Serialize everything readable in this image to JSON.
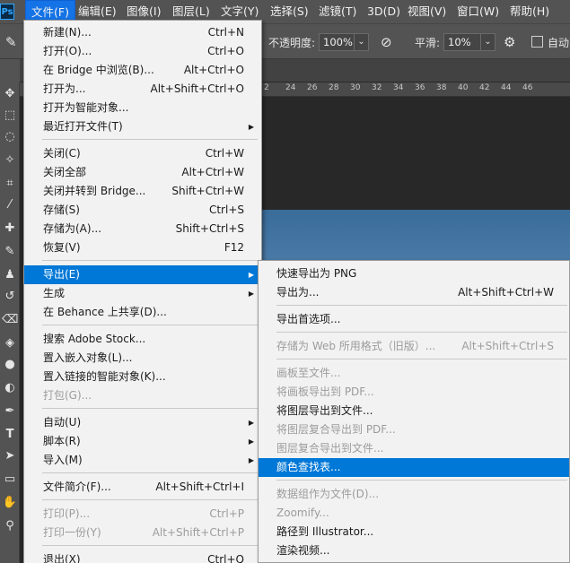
{
  "app": {
    "logo": "Ps"
  },
  "menubar": [
    {
      "label": "文件(F)",
      "active": true
    },
    {
      "label": "编辑(E)"
    },
    {
      "label": "图像(I)"
    },
    {
      "label": "图层(L)"
    },
    {
      "label": "文字(Y)"
    },
    {
      "label": "选择(S)"
    },
    {
      "label": "滤镜(T)"
    },
    {
      "label": "3D(D)"
    },
    {
      "label": "视图(V)"
    },
    {
      "label": "窗口(W)"
    },
    {
      "label": "帮助(H)"
    }
  ],
  "options": {
    "opacity_label": "不透明度:",
    "opacity_value": "100%",
    "smooth_label": "平滑:",
    "smooth_value": "10%",
    "auto_label": "自动"
  },
  "ruler": [
    "2",
    "24",
    "26",
    "28",
    "30",
    "32",
    "34",
    "36",
    "38",
    "40",
    "42",
    "44",
    "46"
  ],
  "file_menu": [
    {
      "label": "新建(N)...",
      "shortcut": "Ctrl+N"
    },
    {
      "label": "打开(O)...",
      "shortcut": "Ctrl+O"
    },
    {
      "label": "在 Bridge 中浏览(B)...",
      "shortcut": "Alt+Ctrl+O"
    },
    {
      "label": "打开为...",
      "shortcut": "Alt+Shift+Ctrl+O"
    },
    {
      "label": "打开为智能对象..."
    },
    {
      "label": "最近打开文件(T)",
      "submenu": true
    },
    {
      "label": "关闭(C)",
      "shortcut": "Ctrl+W"
    },
    {
      "label": "关闭全部",
      "shortcut": "Alt+Ctrl+W"
    },
    {
      "label": "关闭并转到 Bridge...",
      "shortcut": "Shift+Ctrl+W"
    },
    {
      "label": "存储(S)",
      "shortcut": "Ctrl+S"
    },
    {
      "label": "存储为(A)...",
      "shortcut": "Shift+Ctrl+S"
    },
    {
      "label": "恢复(V)",
      "shortcut": "F12"
    },
    {
      "label": "导出(E)",
      "submenu": true,
      "highlighted": true
    },
    {
      "label": "生成",
      "submenu": true
    },
    {
      "label": "在 Behance 上共享(D)..."
    },
    {
      "label": "搜索 Adobe Stock..."
    },
    {
      "label": "置入嵌入对象(L)..."
    },
    {
      "label": "置入链接的智能对象(K)..."
    },
    {
      "label": "打包(G)...",
      "disabled": true
    },
    {
      "label": "自动(U)",
      "submenu": true
    },
    {
      "label": "脚本(R)",
      "submenu": true
    },
    {
      "label": "导入(M)",
      "submenu": true
    },
    {
      "label": "文件简介(F)...",
      "shortcut": "Alt+Shift+Ctrl+I"
    },
    {
      "label": "打印(P)...",
      "shortcut": "Ctrl+P",
      "disabled": true
    },
    {
      "label": "打印一份(Y)",
      "shortcut": "Alt+Shift+Ctrl+P",
      "disabled": true
    },
    {
      "label": "退出(X)",
      "shortcut": "Ctrl+Q"
    }
  ],
  "export_menu": [
    {
      "label": "快速导出为 PNG"
    },
    {
      "label": "导出为...",
      "shortcut": "Alt+Shift+Ctrl+W"
    },
    {
      "label": "导出首选项..."
    },
    {
      "label": "存储为 Web 所用格式（旧版）...",
      "shortcut": "Alt+Shift+Ctrl+S",
      "disabled": true
    },
    {
      "label": "画板至文件...",
      "disabled": true
    },
    {
      "label": "将画板导出到 PDF...",
      "disabled": true
    },
    {
      "label": "将图层导出到文件..."
    },
    {
      "label": "将图层复合导出到 PDF...",
      "disabled": true
    },
    {
      "label": "图层复合导出到文件...",
      "disabled": true
    },
    {
      "label": "颜色查找表...",
      "highlighted": true
    },
    {
      "label": "数据组作为文件(D)...",
      "disabled": true
    },
    {
      "label": "Zoomify...",
      "disabled": true
    },
    {
      "label": "路径到 Illustrator..."
    },
    {
      "label": "渲染视频..."
    }
  ],
  "colors": {
    "chrome": "#535353",
    "menu_bg": "#f2f2f2",
    "highlight": "#0078d7",
    "active_top": "#1473e6"
  }
}
